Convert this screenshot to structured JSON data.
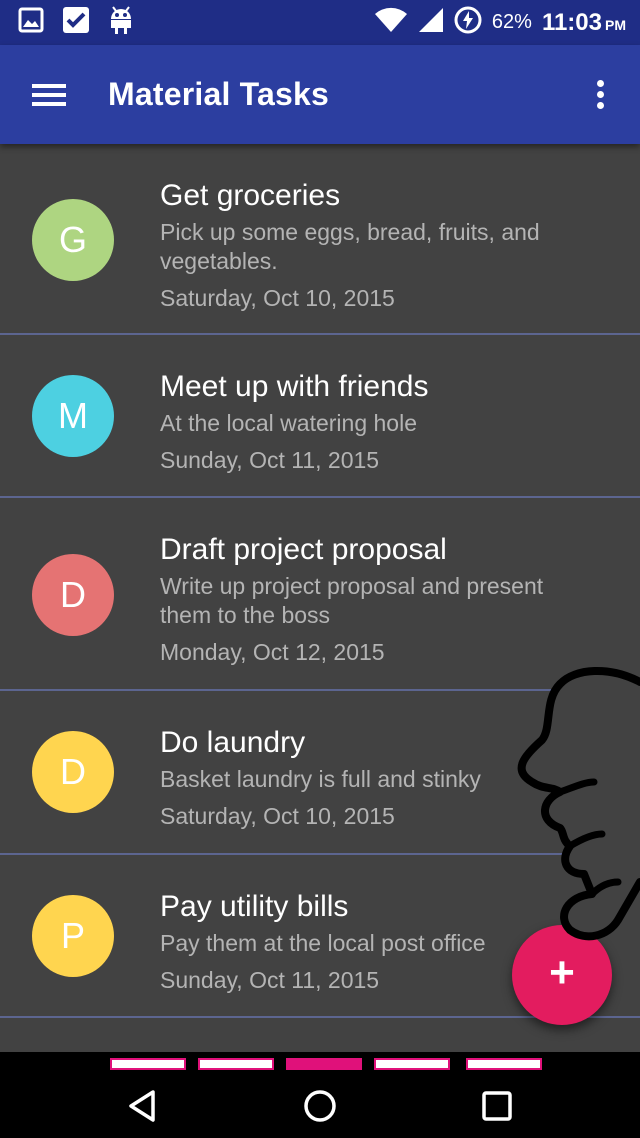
{
  "status_bar": {
    "notification_icons": [
      "image-icon",
      "checkbox-icon",
      "android-icon"
    ],
    "status_icons": [
      "wifi-icon",
      "cell-signal-icon",
      "battery-charging-icon"
    ],
    "battery_percent": "62%",
    "time": "11:03",
    "ampm": "PM"
  },
  "app_bar": {
    "title": "Material Tasks",
    "menu_icon": "hamburger-menu-icon",
    "overflow_icon": "more-vert-icon"
  },
  "tasks": [
    {
      "initial": "G",
      "title": "Get groceries",
      "description": "Pick up some eggs, bread, fruits, and vegetables.",
      "date": "Saturday, Oct 10, 2015",
      "color": "#aed581"
    },
    {
      "initial": "M",
      "title": "Meet up with friends",
      "description": "At the local watering hole",
      "date": "Sunday, Oct 11, 2015",
      "color": "#4dd0e1"
    },
    {
      "initial": "D",
      "title": "Draft project proposal",
      "description": "Write up project proposal and present them to the boss",
      "date": "Monday, Oct 12, 2015",
      "color": "#e57373"
    },
    {
      "initial": "D",
      "title": "Do laundry",
      "description": "Basket laundry is full and stinky",
      "date": "Saturday, Oct 10, 2015",
      "color": "#ffd54f"
    },
    {
      "initial": "P",
      "title": "Pay utility bills",
      "description": "Pay them at the local post office",
      "date": "Sunday, Oct 11, 2015",
      "color": "#ffd54f"
    }
  ],
  "fab": {
    "label": "+",
    "icon": "add-icon",
    "color": "#e31c5f"
  },
  "colors": {
    "status_bar": "#1f2d86",
    "app_bar": "#2c3ea0",
    "list_background": "#424242",
    "divider": "#5c6590",
    "nav_indicator": "#e0117a"
  },
  "nav_bar": {
    "buttons": [
      "back-icon",
      "home-icon",
      "recents-icon"
    ],
    "page_indicator_count": 5,
    "page_indicator_active": 3
  }
}
